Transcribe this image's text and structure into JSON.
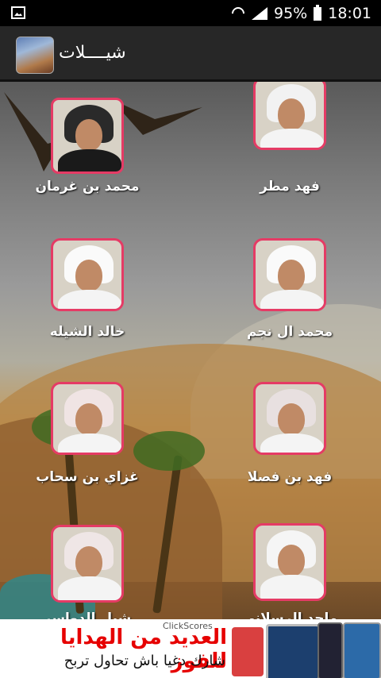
{
  "status_bar": {
    "battery": "95%",
    "time": "18:01",
    "icons": [
      "gallery-icon",
      "wifi-icon",
      "signal-icon",
      "battery-icon"
    ]
  },
  "app_bar": {
    "title": "شيــــلات",
    "icon": "app-launcher-icon"
  },
  "singers": [
    {
      "name": "فهد مطر"
    },
    {
      "name": "محمد بن غرمان"
    },
    {
      "name": "محمد ال نجم"
    },
    {
      "name": "خالد الشيله"
    },
    {
      "name": "فهد بن فصلا"
    },
    {
      "name": "غزاي بن سحاب"
    },
    {
      "name": "ماجد الرسلاني"
    },
    {
      "name": "شبل الدواسر"
    }
  ],
  "ad_banner": {
    "brand": "ClickScores",
    "headline": "العديد من الهدايا للفوز",
    "subtext": "شارك دغيا باش تحاول تربح"
  },
  "colors": {
    "accent_border": "#e53b65",
    "app_bar_bg": "#272727",
    "ad_headline": "#e60000"
  }
}
